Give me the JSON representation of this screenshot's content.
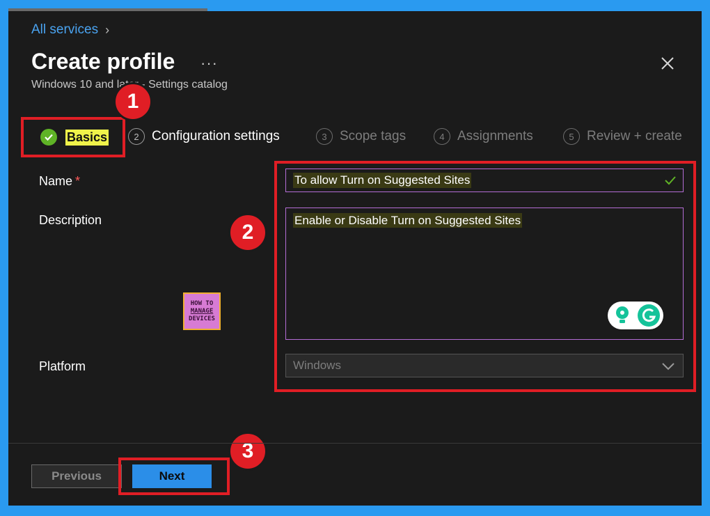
{
  "breadcrumb": {
    "label": "All services"
  },
  "header": {
    "title": "Create profile",
    "more": "···",
    "subtitle": "Windows 10 and later - Settings catalog"
  },
  "steps": [
    {
      "num": "",
      "label": "Basics",
      "state": "completed"
    },
    {
      "num": "2",
      "label": "Configuration settings",
      "state": "current"
    },
    {
      "num": "3",
      "label": "Scope tags",
      "state": "upcoming"
    },
    {
      "num": "4",
      "label": "Assignments",
      "state": "upcoming"
    },
    {
      "num": "5",
      "label": "Review + create",
      "state": "upcoming"
    }
  ],
  "form": {
    "name_label": "Name",
    "required_mark": "*",
    "name_value": "To allow Turn on Suggested Sites",
    "description_label": "Description",
    "description_value": "Enable or Disable Turn on Suggested Sites",
    "platform_label": "Platform",
    "platform_value": "Windows"
  },
  "callouts": [
    "1",
    "2",
    "3"
  ],
  "logo": {
    "line1": "HOW TO",
    "line2": "MANAGE",
    "line3": "DEVICES"
  },
  "footer": {
    "previous_label": "Previous",
    "next_label": "Next"
  },
  "colors": {
    "accent_blue": "#2b8ee8",
    "callout_red": "#e01e25",
    "highlight_yellow": "#f0f24a",
    "check_green": "#5fb326",
    "input_border": "#b46ed6"
  },
  "icons": {
    "close": "close-icon",
    "check": "check-icon",
    "chevron": "chevron-down-icon",
    "grammarly": "grammarly-icon"
  }
}
